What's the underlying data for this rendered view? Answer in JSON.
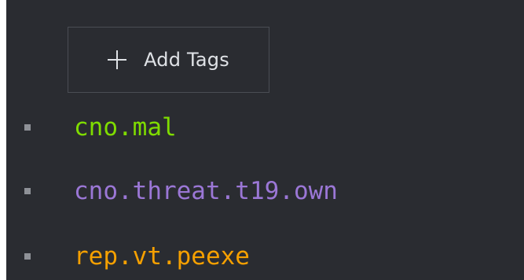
{
  "add_tags_button": {
    "label": "Add Tags",
    "icon": "plus-icon"
  },
  "tags": [
    {
      "name": "cno.mal",
      "color": "#7fdc00"
    },
    {
      "name": "cno.threat.t19.own",
      "color": "#9b77d6"
    },
    {
      "name": "rep.vt.peexe",
      "color": "#f5a000"
    }
  ]
}
